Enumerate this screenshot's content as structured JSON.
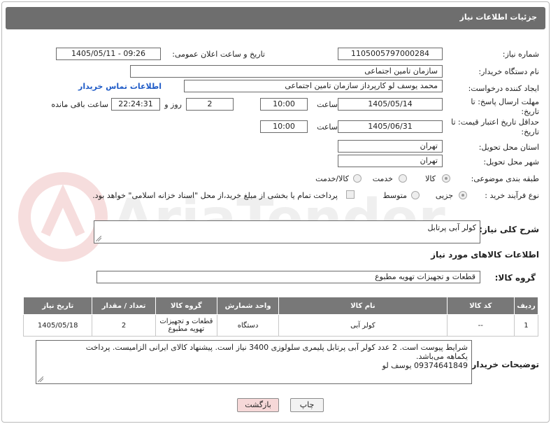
{
  "header": {
    "title": "جزئیات اطلاعات نیاز"
  },
  "fields": {
    "need_number_label": "شماره نیاز:",
    "need_number": "1105005797000284",
    "announce_label": "تاریخ و ساعت اعلان عمومی:",
    "announce_value": "1405/05/11 - 09:26",
    "buyer_org_label": "نام دستگاه خریدار:",
    "buyer_org": "سازمان تامین اجتماعی",
    "creator_label": "ایجاد کننده درخواست:",
    "creator": "محمد یوسف لو کارپرداز سازمان تامین اجتماعی",
    "contact_link": "اطلاعات تماس خریدار",
    "deadline_label": "مهلت ارسال پاسخ: تا تاریخ:",
    "deadline_date": "1405/05/14",
    "time_label": "ساعت",
    "deadline_time": "10:00",
    "days_value": "2",
    "days_label": "روز و",
    "remaining_value": "22:24:31",
    "remaining_label": "ساعت باقی مانده",
    "validity_label": "حداقل تاریخ اعتبار قیمت: تا تاریخ:",
    "validity_date": "1405/06/31",
    "validity_time": "10:00",
    "province_label": "استان محل تحویل:",
    "province": "تهران",
    "city_label": "شهر محل تحویل:",
    "city": "تهران",
    "category_label": "طبقه بندی موضوعی:",
    "category_options": [
      "کالا",
      "خدمت",
      "کالا/خدمت"
    ],
    "process_label": "نوع فرآیند خرید :",
    "process_options": [
      "جزیی",
      "متوسط"
    ],
    "payment_note": "پرداخت تمام یا بخشی از مبلغ خرید،از محل \"اسناد خزانه اسلامی\" خواهد بود."
  },
  "description": {
    "label": "شرح کلی نیاز:",
    "value": "کولر آبی پرتابل"
  },
  "goods": {
    "section_title": "اطلاعات کالاهای مورد نیاز",
    "group_label": "گروه کالا:",
    "group_value": "قطعات و تجهیزات تهویه مطبوع",
    "columns": [
      "ردیف",
      "کد کالا",
      "نام کالا",
      "واحد شمارش",
      "گروه کالا",
      "تعداد / مقدار",
      "تاریخ نیاز"
    ],
    "rows": [
      {
        "row": "1",
        "code": "--",
        "name": "کولر آبی",
        "unit": "دستگاه",
        "group": "قطعات و تجهیزات تهویه مطبوع",
        "qty": "2",
        "date": "1405/05/18"
      }
    ]
  },
  "buyer_notes": {
    "label": "توضیحات خریدار:",
    "line1": "شرایط پیوست است. 2 عدد کولر آبی پرتابل پلیمری سلولوزی 3400 نیاز است. پیشنهاد کالای ایرانی الزامیست. پرداخت",
    "line2": "یکماهه می‌باشد.",
    "line3": "09374641849 یوسف لو"
  },
  "buttons": {
    "print": "چاپ",
    "back": "بازگشت"
  },
  "watermark": "AriaTender.neT",
  "colors": {
    "header_bg": "#6e6e6e",
    "table_header_bg": "#787878",
    "link": "#1f5bc7",
    "back_btn_bg": "#f6d8d8"
  }
}
